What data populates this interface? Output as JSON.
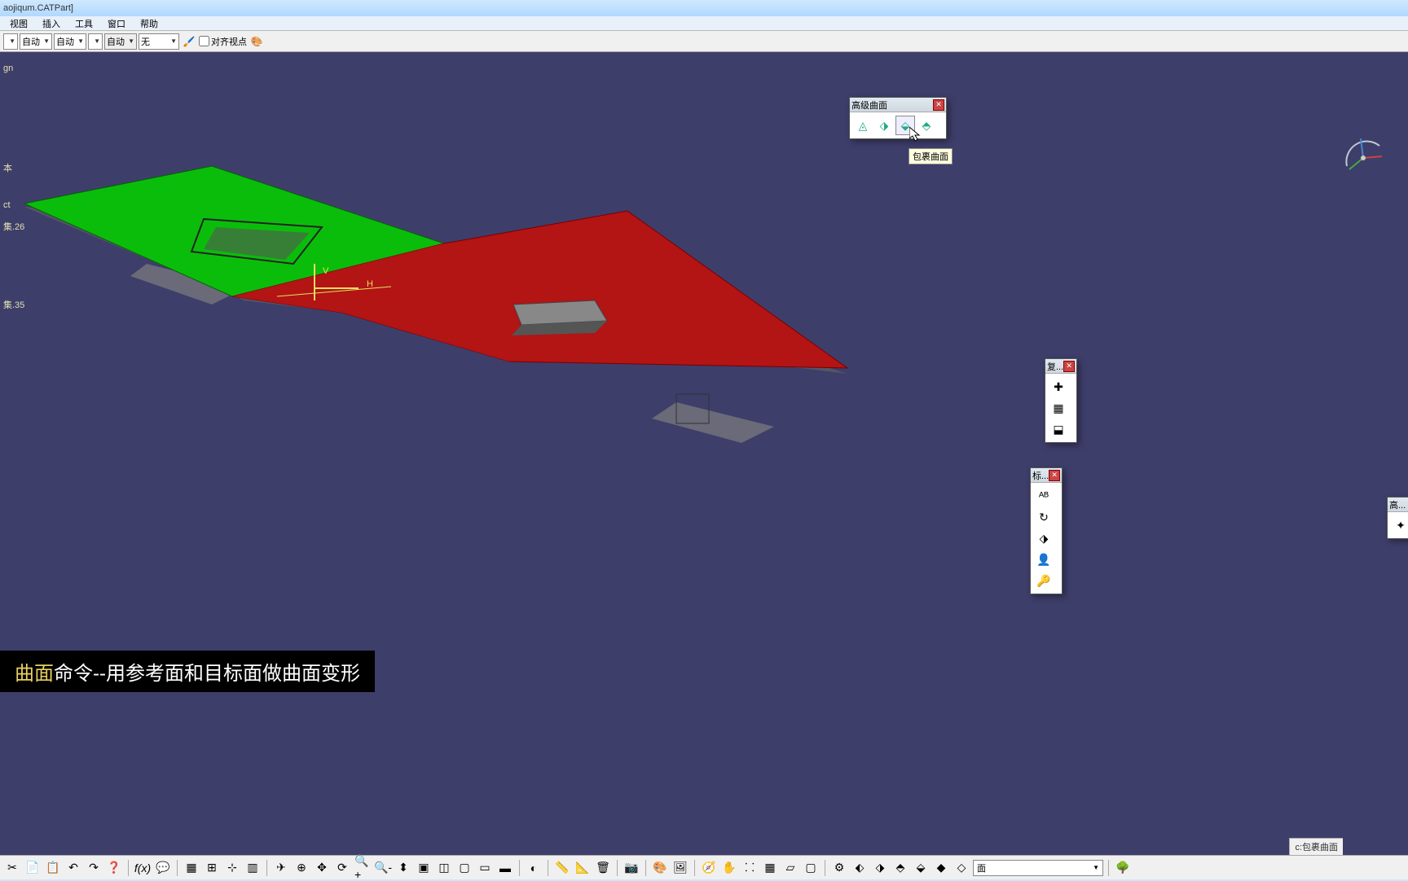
{
  "window": {
    "title": "aojiqum.CATPart]"
  },
  "menu": {
    "items": [
      "视图",
      "插入",
      "工具",
      "窗口",
      "帮助"
    ]
  },
  "toolbar_top": {
    "dd1": "",
    "dd2": "自动",
    "dd3": "自动",
    "dd4": "",
    "dd5": "自动",
    "dd6": "无",
    "checkbox_label": "对齐视点"
  },
  "tree": {
    "l0": "gn",
    "l1": "本",
    "l2": "ct",
    "l3": "集.26",
    "l4": "集.35"
  },
  "float_panel_main": {
    "title": "高级曲面",
    "tooltip": "包裹曲面"
  },
  "float_panel_2": {
    "title": "复..."
  },
  "float_panel_3": {
    "title": "标..."
  },
  "float_panel_4": {
    "title": "高..."
  },
  "caption": {
    "hl": "曲面",
    "rest": "命令--用参考面和目标面做曲面变形"
  },
  "status": {
    "hint": "c:包裹曲面"
  },
  "bottom_dd": {
    "value": "面"
  },
  "axis_labels": {
    "v": "V",
    "h": "H"
  }
}
